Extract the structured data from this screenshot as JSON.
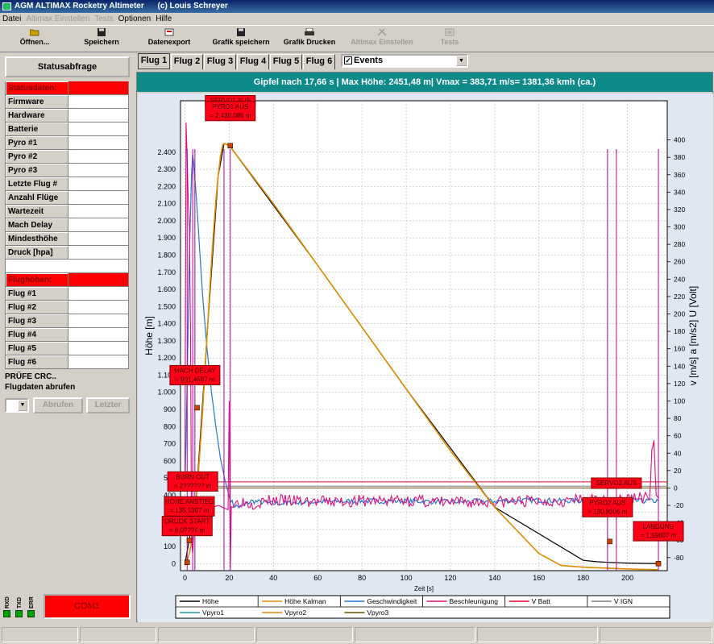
{
  "window": {
    "title": "AGM ALTIMAX Rocketry Altimeter",
    "copyright": "(c) Louis Schreyer"
  },
  "menu": [
    {
      "label": "Datei",
      "enabled": true
    },
    {
      "label": "Altimax Einstellen",
      "enabled": false
    },
    {
      "label": "Tests",
      "enabled": false
    },
    {
      "label": "Optionen",
      "enabled": true
    },
    {
      "label": "Hilfe",
      "enabled": true
    }
  ],
  "toolbar": {
    "open": "Öffnen...",
    "save": "Speichern",
    "export": "Datenexport",
    "save_graph": "Grafik speichern",
    "print_graph": "Grafik Drucken",
    "altimax_settings": "Altimax Einstellen",
    "tests": "Tests"
  },
  "left_panel": {
    "status_button": "Statusabfrage",
    "status_header": "Statusdaten:",
    "status_rows": [
      "Firmware",
      "Hardware",
      "Batterie",
      "Pyro #1",
      "Pyro #2",
      "Pyro #3",
      "Letzte Flug #",
      "Anzahl Flüge",
      "Wartezeit",
      "Mach Delay",
      "Mindesthöhe",
      "Druck [hpa]"
    ],
    "flights_header": "Flughöhen:",
    "flight_rows": [
      "Flug #1",
      "Flug #2",
      "Flug #3",
      "Flug #4",
      "Flug #5",
      "Flug #6"
    ],
    "crc_text": "PRÜFE CRC..",
    "fetch_label": "Flugdaten abrufen",
    "fetch_button": "Abrufen",
    "last_button": "Letzter",
    "leds": [
      "RXD",
      "TXD",
      "ERR"
    ],
    "port": "COM1"
  },
  "tabs": [
    "Flug 1",
    "Flug 2",
    "Flug 3",
    "Flug 4",
    "Flug 5",
    "Flug 6"
  ],
  "active_tab": 0,
  "events_combo": {
    "label": "Events",
    "checked": true
  },
  "summary": "Gipfel nach 17,66 s | Max Höhe: 2451,48 m| Vmax = 383,71 m/s= 1381,36 kmh (ca.)",
  "chart_data": {
    "type": "line",
    "xlabel": "Zeit [s]",
    "ylabel_left": "Höhe [m]",
    "ylabel_right": "v [m/s]   a [m/s2]   U [Volt]",
    "xlim": [
      -2,
      218
    ],
    "x_ticks": [
      0,
      20,
      40,
      60,
      80,
      100,
      120,
      140,
      160,
      180,
      200
    ],
    "ylim_left": [
      -40,
      2700
    ],
    "y_ticks_left": [
      "0",
      "100",
      "200",
      "300",
      "400",
      "500",
      "600",
      "700",
      "800",
      "900",
      "1.000",
      "1.100",
      "1.200",
      "1.300",
      "1.400",
      "1.500",
      "1.600",
      "1.700",
      "1.800",
      "1.900",
      "2.000",
      "2.100",
      "2.200",
      "2.300",
      "2.400"
    ],
    "ylim_right": [
      -95,
      445
    ],
    "y_ticks_right": [
      -80,
      -60,
      -40,
      -20,
      0,
      20,
      40,
      60,
      80,
      100,
      120,
      140,
      160,
      180,
      200,
      220,
      240,
      260,
      280,
      300,
      320,
      340,
      360,
      380,
      400
    ],
    "grid": true,
    "legend_position": "bottom",
    "legend": [
      {
        "name": "Höhe",
        "color": "#000000"
      },
      {
        "name": "Höhe Kalman",
        "color": "#e08a00"
      },
      {
        "name": "Geschwindigkeit",
        "color": "#1f77d0"
      },
      {
        "name": "Beschleunigung",
        "color": "#e0107e"
      },
      {
        "name": "V Batt",
        "color": "#e0002a"
      },
      {
        "name": "V IGN",
        "color": "#7f7f7f"
      },
      {
        "name": "Vpyro1",
        "color": "#1f9aaa"
      },
      {
        "name": "Vpyro2",
        "color": "#e08a00"
      },
      {
        "name": "Vpyro3",
        "color": "#6b4a00"
      }
    ],
    "altitude": {
      "x": [
        0,
        1,
        2,
        3,
        4,
        5,
        6,
        7,
        8,
        9,
        10,
        11,
        12,
        13,
        14,
        15,
        16,
        17,
        17.66,
        20,
        40,
        60,
        80,
        100,
        120,
        140,
        160,
        170,
        180,
        190,
        195,
        200,
        205,
        210,
        214
      ],
      "y": [
        0,
        20,
        60,
        130,
        230,
        360,
        520,
        700,
        900,
        1110,
        1330,
        1550,
        1760,
        1950,
        2120,
        2260,
        2370,
        2440,
        2451,
        2440,
        2100,
        1740,
        1380,
        1020,
        660,
        330,
        60,
        -10,
        -20,
        -25,
        -28,
        -30,
        -32,
        -33,
        -35
      ]
    },
    "altitude_rough": {
      "x": [
        0,
        5,
        10,
        15,
        17.66,
        20,
        60,
        100,
        140,
        180,
        186,
        192,
        196,
        200,
        205,
        210,
        214
      ],
      "y": [
        0,
        360,
        1330,
        2260,
        2451,
        2440,
        1740,
        1020,
        330,
        20,
        12,
        8,
        6,
        4,
        3,
        2,
        2
      ]
    },
    "velocity": {
      "x": [
        0,
        1,
        2,
        3,
        3.5,
        4,
        5,
        6,
        7,
        8,
        10,
        12,
        14,
        16,
        18,
        20,
        22,
        25,
        30,
        40,
        60,
        80,
        100,
        120,
        140,
        160,
        180,
        200,
        214
      ],
      "y": [
        0,
        120,
        270,
        360,
        383,
        372,
        340,
        300,
        260,
        220,
        160,
        110,
        70,
        35,
        10,
        -10,
        -20,
        -22,
        -15,
        -18,
        -16,
        -15,
        -15,
        -16,
        -15,
        -14,
        -15,
        -15,
        -15
      ]
    },
    "acceleration": {
      "x": [
        0,
        0.5,
        1,
        1.5,
        2,
        2.5,
        3,
        3.5,
        4,
        5,
        6,
        8,
        10,
        15,
        19.5,
        20,
        20.5,
        21,
        25,
        30,
        40,
        60,
        80,
        100,
        120,
        140,
        160,
        180,
        190,
        200,
        205,
        210,
        211,
        212,
        213,
        214
      ],
      "y": [
        0,
        420,
        380,
        330,
        300,
        180,
        -60,
        -75,
        -50,
        -40,
        -35,
        -30,
        -25,
        -20,
        -25,
        100,
        -85,
        -20,
        -15,
        -18,
        -14,
        -16,
        -15,
        -14,
        -17,
        -16,
        -15,
        -14,
        -15,
        -13,
        -10,
        -12,
        40,
        55,
        -15,
        -12
      ]
    },
    "v_batt": {
      "x": [
        -2,
        218
      ],
      "y": [
        7,
        7
      ]
    },
    "v_ign": {
      "x": [
        -2,
        218
      ],
      "y": [
        2,
        2
      ]
    },
    "vpyro1": {
      "x": [
        -2,
        218
      ],
      "y": [
        0,
        0
      ]
    },
    "vpyro2": {
      "x": [
        -2,
        218
      ],
      "y": [
        0,
        0
      ]
    },
    "vpyro3": {
      "x": [
        -2,
        218
      ],
      "y": [
        0,
        0
      ]
    },
    "event_lines": [
      {
        "x": 1.0,
        "label": "DRUCK START"
      },
      {
        "x": 3.5,
        "label": "BURN OUT"
      },
      {
        "x": 4.5,
        "label": "MACH DELAY"
      },
      {
        "x": 17.66,
        "label": "PYRO1 AUS"
      },
      {
        "x": 20.5,
        "label": "SERVO1 AUS"
      },
      {
        "x": 191.0,
        "label": "PYRO2 AUS"
      },
      {
        "x": 195.0,
        "label": "SERVO2 AUS"
      },
      {
        "x": 214.0,
        "label": "LANDUNG"
      }
    ],
    "event_markers": [
      {
        "x": 1.0,
        "y": 8
      },
      {
        "x": 2.0,
        "y": 136
      },
      {
        "x": 5.5,
        "y": 910
      },
      {
        "x": 20.5,
        "y": 2438
      },
      {
        "x": 192.0,
        "y": 130
      },
      {
        "x": 214.0,
        "y": 1
      }
    ],
    "annotations": [
      {
        "text1": "SERVO1 AUS",
        "text2": "",
        "x": 20.5,
        "y": 2700
      },
      {
        "text1": "PYRO1 AUS",
        "text2": "= 2.438,086 m",
        "x": 20.5,
        "y": 2640
      },
      {
        "text1": "MACH DELAY",
        "text2": "= 901,4587 m",
        "x": 4.5,
        "y": 1100
      },
      {
        "text1": "BURN OUT",
        "text2": "= 2?????? m",
        "x": 3.5,
        "y": 480
      },
      {
        "text1": "HÖHE ANSTIEG",
        "text2": "= 135,5397 m",
        "x": 2.0,
        "y": 335
      },
      {
        "text1": "DRUCK START",
        "text2": "= 8,0???4 m",
        "x": 1.0,
        "y": 220
      },
      {
        "text1": "SERVO2 AUS",
        "text2": "",
        "x": 195.0,
        "y": 470
      },
      {
        "text1": "PYRO2 AUS",
        "text2": "= 130,8306 m",
        "x": 191.0,
        "y": 330
      },
      {
        "text1": "LANDUNG",
        "text2": "= 1,59807 m",
        "x": 214.0,
        "y": 190
      }
    ]
  }
}
